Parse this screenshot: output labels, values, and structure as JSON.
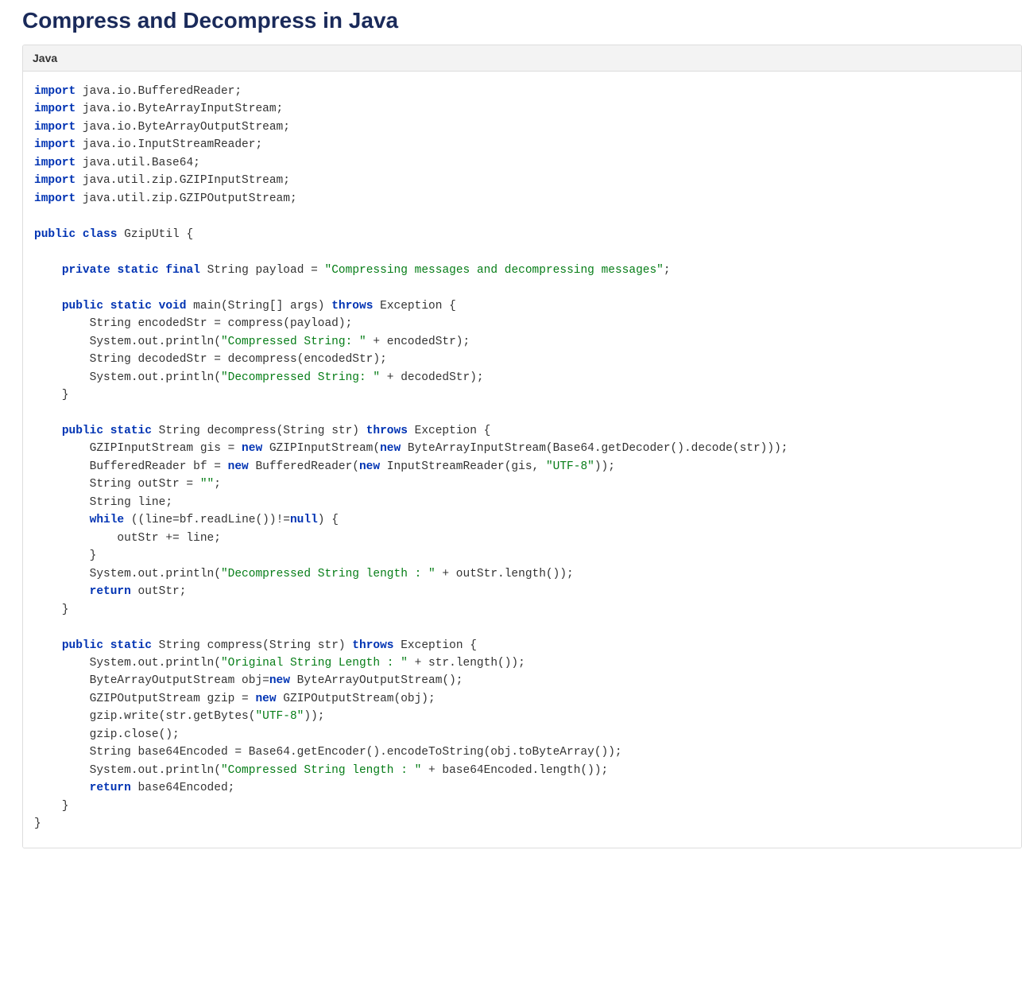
{
  "heading": "Compress and Decompress in Java",
  "panel_title": "Java",
  "code": {
    "imports": [
      "java.io.BufferedReader",
      "java.io.ByteArrayInputStream",
      "java.io.ByteArrayOutputStream",
      "java.io.InputStreamReader",
      "java.util.Base64",
      "java.util.zip.GZIPInputStream",
      "java.util.zip.GZIPOutputStream"
    ],
    "class_name": "GzipUtil",
    "payload_field": {
      "modifiers": "private static final",
      "type": "String",
      "name": "payload",
      "value": "\"Compressing messages and decompressing messages\""
    },
    "main_method": {
      "signature_keywords": "public static void",
      "name": "main",
      "params": "String[] args",
      "throws": "Exception",
      "body": [
        "String encodedStr = compress(payload);",
        {
          "prefix": "System.out.println(",
          "str": "\"Compressed String: \"",
          "suffix": " + encodedStr);"
        },
        "String decodedStr = decompress(encodedStr);",
        {
          "prefix": "System.out.println(",
          "str": "\"Decompressed String: \"",
          "suffix": " + decodedStr);"
        }
      ]
    },
    "decompress_method": {
      "signature_keywords": "public static",
      "return_type": "String",
      "name": "decompress",
      "params": "String str",
      "throws": "Exception",
      "body": [
        {
          "tokens": [
            {
              "t": "GZIPInputStream gis = "
            },
            {
              "t": "new",
              "kw": true
            },
            {
              "t": " GZIPInputStream("
            },
            {
              "t": "new",
              "kw": true
            },
            {
              "t": " ByteArrayInputStream(Base64.getDecoder().decode(str)));"
            }
          ]
        },
        {
          "tokens": [
            {
              "t": "BufferedReader bf = "
            },
            {
              "t": "new",
              "kw": true
            },
            {
              "t": " BufferedReader("
            },
            {
              "t": "new",
              "kw": true
            },
            {
              "t": " InputStreamReader(gis, "
            },
            {
              "t": "\"UTF-8\"",
              "str": true
            },
            {
              "t": "));"
            }
          ]
        },
        {
          "tokens": [
            {
              "t": "String outStr = "
            },
            {
              "t": "\"\"",
              "str": true
            },
            {
              "t": ";"
            }
          ]
        },
        "String line;",
        {
          "tokens": [
            {
              "t": "while",
              "kw": true
            },
            {
              "t": " ((line=bf.readLine())!="
            },
            {
              "t": "null",
              "kw": true
            },
            {
              "t": ") {"
            }
          ]
        },
        {
          "indent": 1,
          "t": "outStr += line;"
        },
        "}",
        {
          "tokens": [
            {
              "t": "System.out.println("
            },
            {
              "t": "\"Decompressed String length : \"",
              "str": true
            },
            {
              "t": " + outStr.length());"
            }
          ]
        },
        {
          "tokens": [
            {
              "t": "return",
              "kw": true
            },
            {
              "t": " outStr;"
            }
          ]
        }
      ]
    },
    "compress_method": {
      "signature_keywords": "public static",
      "return_type": "String",
      "name": "compress",
      "params": "String str",
      "throws": "Exception",
      "body": [
        {
          "tokens": [
            {
              "t": "System.out.println("
            },
            {
              "t": "\"Original String Length : \"",
              "str": true
            },
            {
              "t": " + str.length());"
            }
          ]
        },
        {
          "tokens": [
            {
              "t": "ByteArrayOutputStream obj="
            },
            {
              "t": "new",
              "kw": true
            },
            {
              "t": " ByteArrayOutputStream();"
            }
          ]
        },
        {
          "tokens": [
            {
              "t": "GZIPOutputStream gzip = "
            },
            {
              "t": "new",
              "kw": true
            },
            {
              "t": " GZIPOutputStream(obj);"
            }
          ]
        },
        {
          "tokens": [
            {
              "t": "gzip.write(str.getBytes("
            },
            {
              "t": "\"UTF-8\"",
              "str": true
            },
            {
              "t": "));"
            }
          ]
        },
        "gzip.close();",
        "String base64Encoded = Base64.getEncoder().encodeToString(obj.toByteArray());",
        {
          "tokens": [
            {
              "t": "System.out.println("
            },
            {
              "t": "\"Compressed String length : \"",
              "str": true
            },
            {
              "t": " + base64Encoded.length());"
            }
          ]
        },
        {
          "tokens": [
            {
              "t": "return",
              "kw": true
            },
            {
              "t": " base64Encoded;"
            }
          ]
        }
      ]
    }
  }
}
